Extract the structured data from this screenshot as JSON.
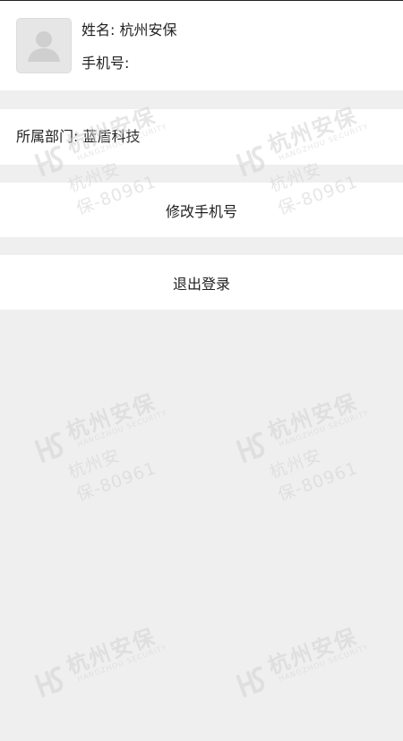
{
  "profile": {
    "name_label": "姓名:",
    "name_value": "杭州安保",
    "phone_label": "手机号:",
    "phone_value": ""
  },
  "department": {
    "label": "所属部门:",
    "value": "蓝盾科技"
  },
  "actions": {
    "modify_phone": "修改手机号",
    "logout": "退出登录"
  },
  "watermark": {
    "brand": "杭州安保",
    "subtitle": "HANGZHOU SECURITY",
    "contact": "杭州安保-80961"
  }
}
